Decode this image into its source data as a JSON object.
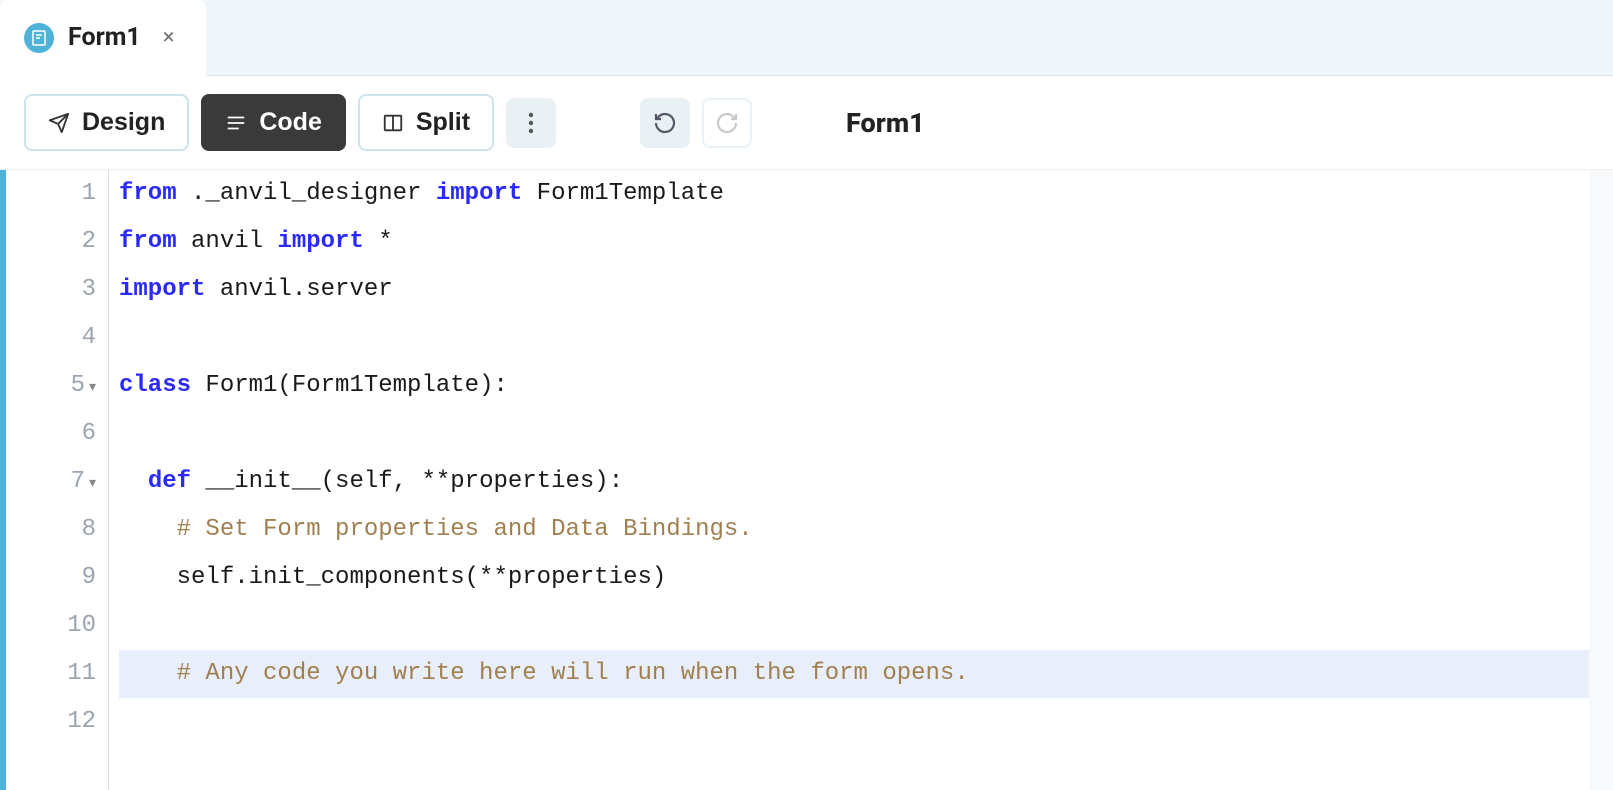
{
  "tab": {
    "title": "Form1"
  },
  "toolbar": {
    "design_label": "Design",
    "code_label": "Code",
    "split_label": "Split"
  },
  "breadcrumb": {
    "title": "Form1"
  },
  "code": {
    "lines": [
      {
        "n": "1",
        "fold": "",
        "tokens": [
          [
            "kw",
            "from"
          ],
          [
            "pl",
            " ._anvil_designer "
          ],
          [
            "kw",
            "import"
          ],
          [
            "pl",
            " Form1Template"
          ]
        ]
      },
      {
        "n": "2",
        "fold": "",
        "tokens": [
          [
            "kw",
            "from"
          ],
          [
            "pl",
            " anvil "
          ],
          [
            "kw",
            "import"
          ],
          [
            "pl",
            " *"
          ]
        ]
      },
      {
        "n": "3",
        "fold": "",
        "tokens": [
          [
            "kw",
            "import"
          ],
          [
            "pl",
            " anvil.server"
          ]
        ]
      },
      {
        "n": "4",
        "fold": "",
        "tokens": []
      },
      {
        "n": "5",
        "fold": "▾",
        "tokens": [
          [
            "kw",
            "class"
          ],
          [
            "pl",
            " Form1(Form1Template):"
          ]
        ]
      },
      {
        "n": "6",
        "fold": "",
        "tokens": []
      },
      {
        "n": "7",
        "fold": "▾",
        "tokens": [
          [
            "pl",
            "  "
          ],
          [
            "kw",
            "def"
          ],
          [
            "pl",
            " __init__(self, **properties):"
          ]
        ]
      },
      {
        "n": "8",
        "fold": "",
        "tokens": [
          [
            "pl",
            "    "
          ],
          [
            "cm",
            "# Set Form properties and Data Bindings."
          ]
        ]
      },
      {
        "n": "9",
        "fold": "",
        "tokens": [
          [
            "pl",
            "    self.init_components(**properties)"
          ]
        ]
      },
      {
        "n": "10",
        "fold": "",
        "tokens": []
      },
      {
        "n": "11",
        "fold": "",
        "current": true,
        "tokens": [
          [
            "pl",
            "    "
          ],
          [
            "cm",
            "# Any code you write here will run when the form opens."
          ]
        ]
      },
      {
        "n": "12",
        "fold": "",
        "tokens": []
      }
    ]
  }
}
